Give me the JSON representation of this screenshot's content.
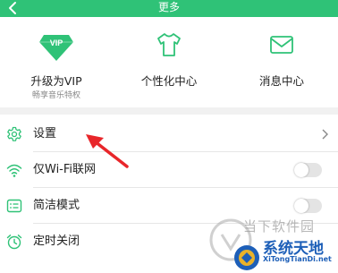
{
  "header": {
    "title": "更多"
  },
  "features": [
    {
      "label": "升级为VIP",
      "sub": "畅享音乐特权",
      "icon": "vip-diamond-icon",
      "icon_text": "VIP"
    },
    {
      "label": "个性化中心",
      "icon": "tshirt-icon"
    },
    {
      "label": "消息中心",
      "icon": "envelope-icon"
    }
  ],
  "settings": [
    {
      "label": "设置",
      "icon": "gear-icon",
      "control": "chevron"
    },
    {
      "label": "仅Wi-Fi联网",
      "icon": "wifi-icon",
      "control": "toggle",
      "on": false
    },
    {
      "label": "简洁模式",
      "icon": "list-icon",
      "control": "toggle",
      "on": false
    },
    {
      "label": "定时关闭",
      "icon": "alarm-clock-icon",
      "control": "none"
    }
  ],
  "watermark": {
    "line1": "当下软件园",
    "line2": "系统天地",
    "line3": "XiTongTianDi.net"
  },
  "colors": {
    "accent": "#2fc277",
    "annotation_arrow": "#e8262a",
    "watermark_blue": "#1d5fb8"
  }
}
